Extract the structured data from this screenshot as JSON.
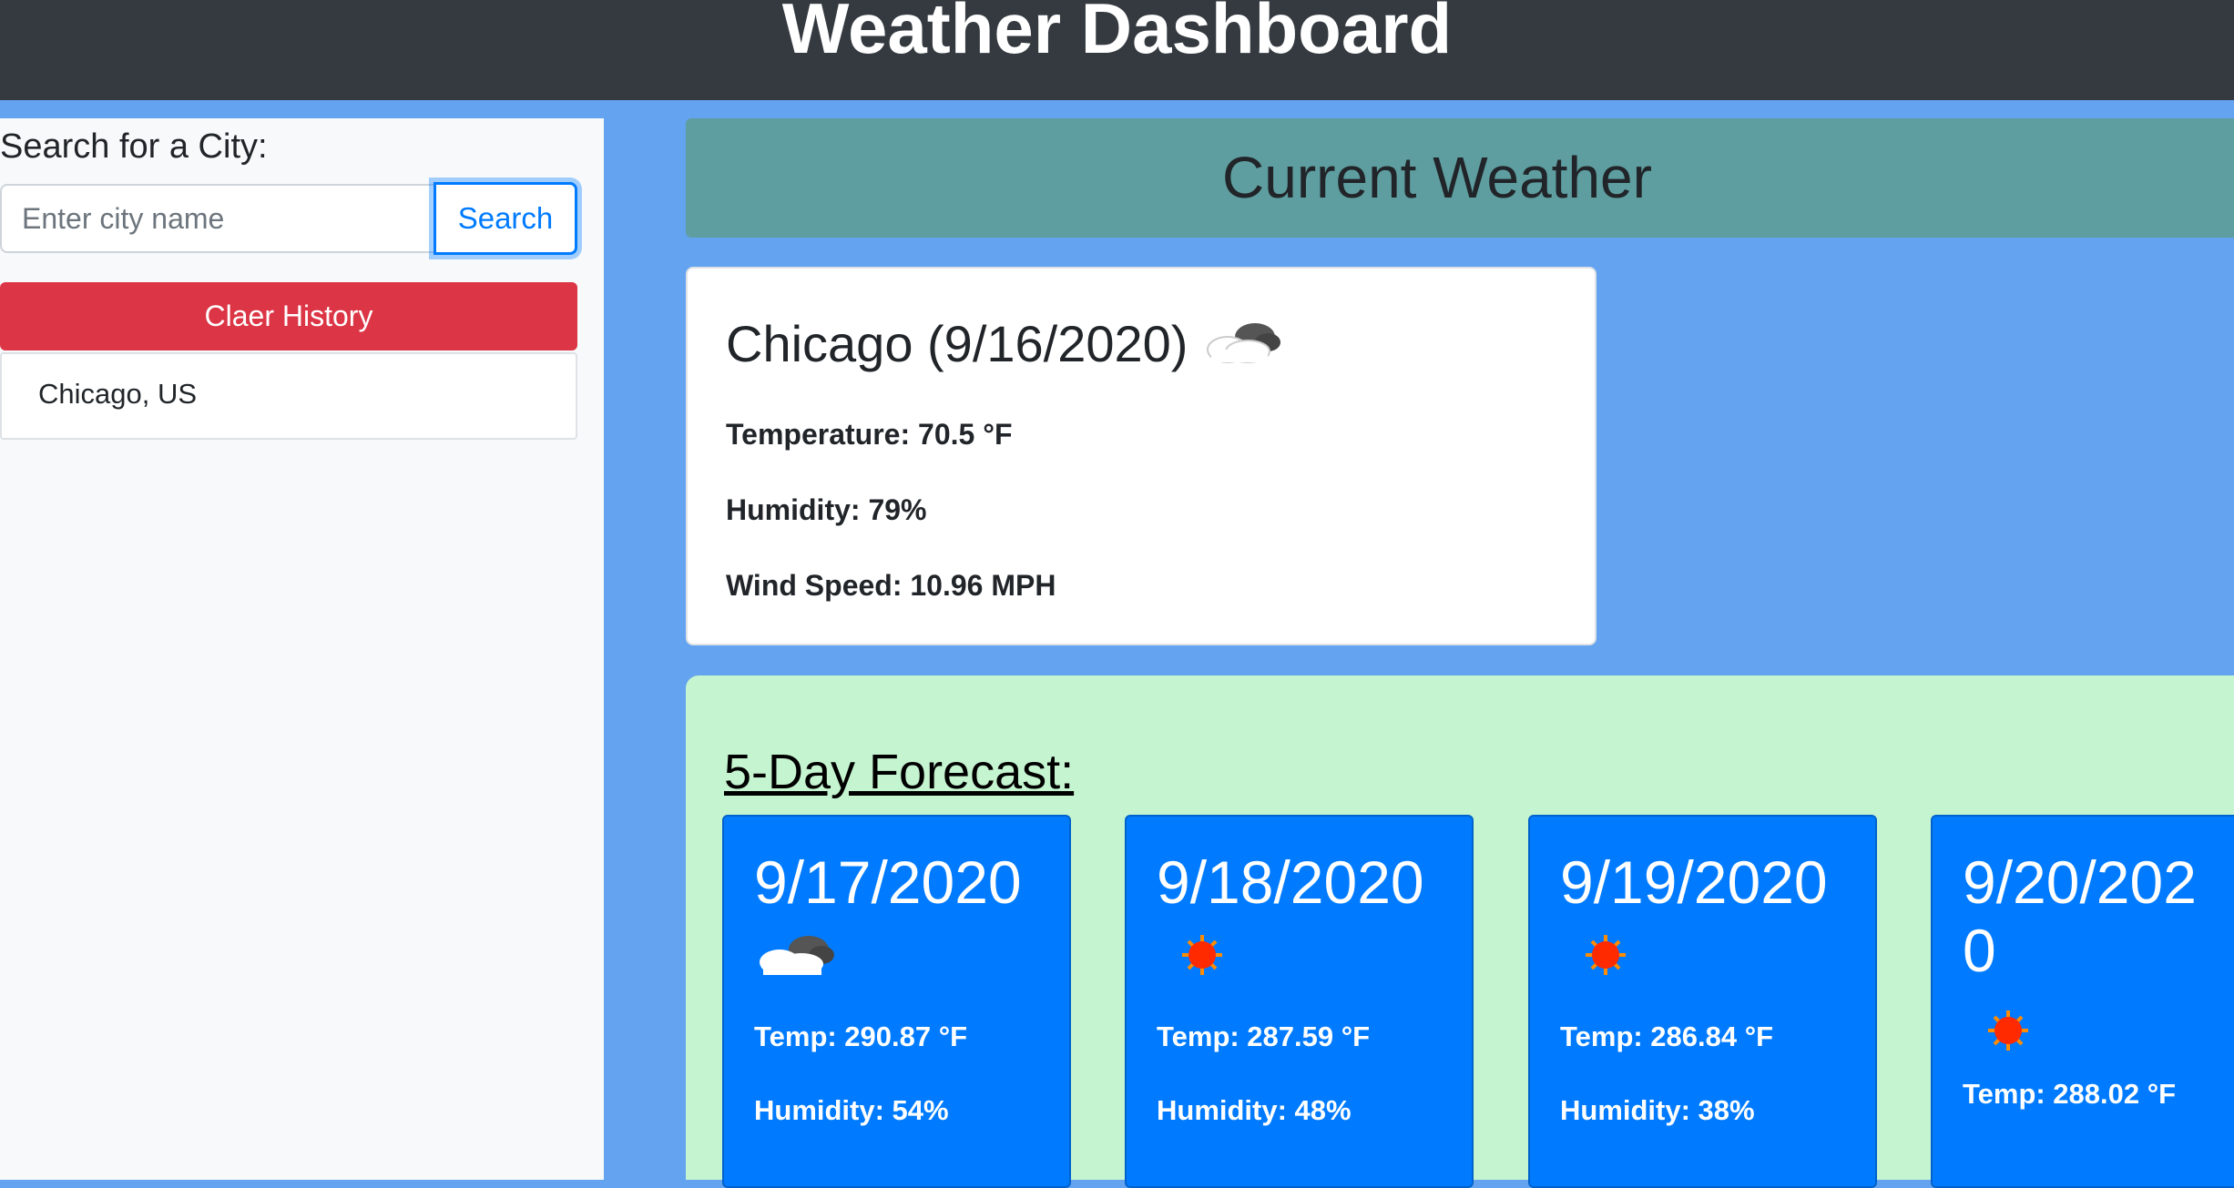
{
  "header": {
    "title": "Weather Dashboard"
  },
  "sidebar": {
    "search_label": "Search for a City:",
    "search_placeholder": "Enter city name",
    "search_button": "Search",
    "clear_button": "Claer History",
    "history": [
      "Chicago, US"
    ]
  },
  "current": {
    "header": "Current Weather",
    "title": "Chicago (9/16/2020)",
    "icon": "cloud-icon",
    "temperature": "Temperature: 70.5 °F",
    "humidity": "Humidity: 79%",
    "wind": "Wind Speed: 10.96 MPH"
  },
  "forecast": {
    "title": "5-Day Forecast:",
    "days": [
      {
        "date": "9/17/2020",
        "icon": "cloud-icon",
        "temp": "Temp: 290.87 °F",
        "humidity": "Humidity: 54%"
      },
      {
        "date": "9/18/2020",
        "icon": "sun-icon",
        "temp": "Temp: 287.59 °F",
        "humidity": "Humidity: 48%"
      },
      {
        "date": "9/19/2020",
        "icon": "sun-icon",
        "temp": "Temp: 286.84 °F",
        "humidity": "Humidity: 38%"
      },
      {
        "date": "9/20/2020",
        "icon": "sun-icon",
        "temp": "Temp: 288.02 °F",
        "humidity": ""
      }
    ]
  },
  "colors": {
    "topbar": "#343a40",
    "background": "#63a3ef",
    "current_header": "#5f9ea0",
    "forecast_panel": "#c5f4d0",
    "day_card": "#007bff",
    "clear_button": "#dc3545"
  }
}
